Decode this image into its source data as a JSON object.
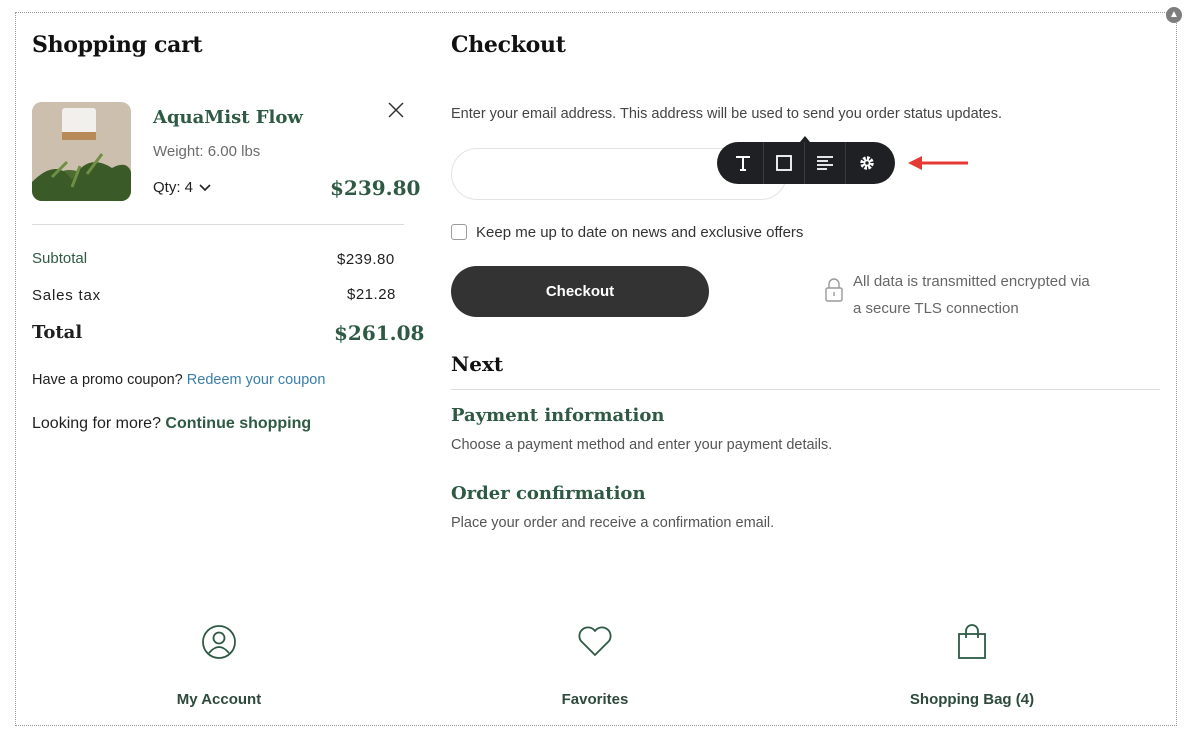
{
  "cart": {
    "title": "Shopping cart",
    "item": {
      "name": "AquaMist Flow",
      "weight": "Weight: 6.00 lbs",
      "qty": "Qty: 4",
      "price": "$239.80"
    },
    "subtotal_label": "Subtotal",
    "subtotal_value": "$239.80",
    "tax_label": "Sales tax",
    "tax_value": "$21.28",
    "total_label": "Total",
    "total_value": "$261.08",
    "promo_text": "Have a promo coupon?",
    "promo_link": "Redeem your coupon",
    "more_text": "Looking for more?",
    "more_link": "Continue shopping"
  },
  "checkout": {
    "title": "Checkout",
    "email_hint": "Enter your email address. This address will be used to send you order status updates.",
    "email_value": "",
    "newsletter_label": "Keep me up to date on news and exclusive offers",
    "button_label": "Checkout",
    "secure_line1": "All data is transmitted encrypted via",
    "secure_line2": "a secure TLS connection",
    "next_title": "Next",
    "steps": [
      {
        "title": "Payment information",
        "desc": "Choose a payment method and enter your payment details."
      },
      {
        "title": "Order confirmation",
        "desc": "Place your order and receive a confirmation email."
      }
    ]
  },
  "toolbar": {
    "icons": [
      "text-icon",
      "square-icon",
      "align-left-icon",
      "gear-icon"
    ]
  },
  "nav": {
    "account_label": "My Account",
    "favorites_label": "Favorites",
    "bag_label": "Shopping Bag (4)"
  },
  "colors": {
    "accent_green": "#2e5a44",
    "link_blue": "#3a7fa8",
    "button_dark": "#333333",
    "arrow_red": "#e53935"
  }
}
